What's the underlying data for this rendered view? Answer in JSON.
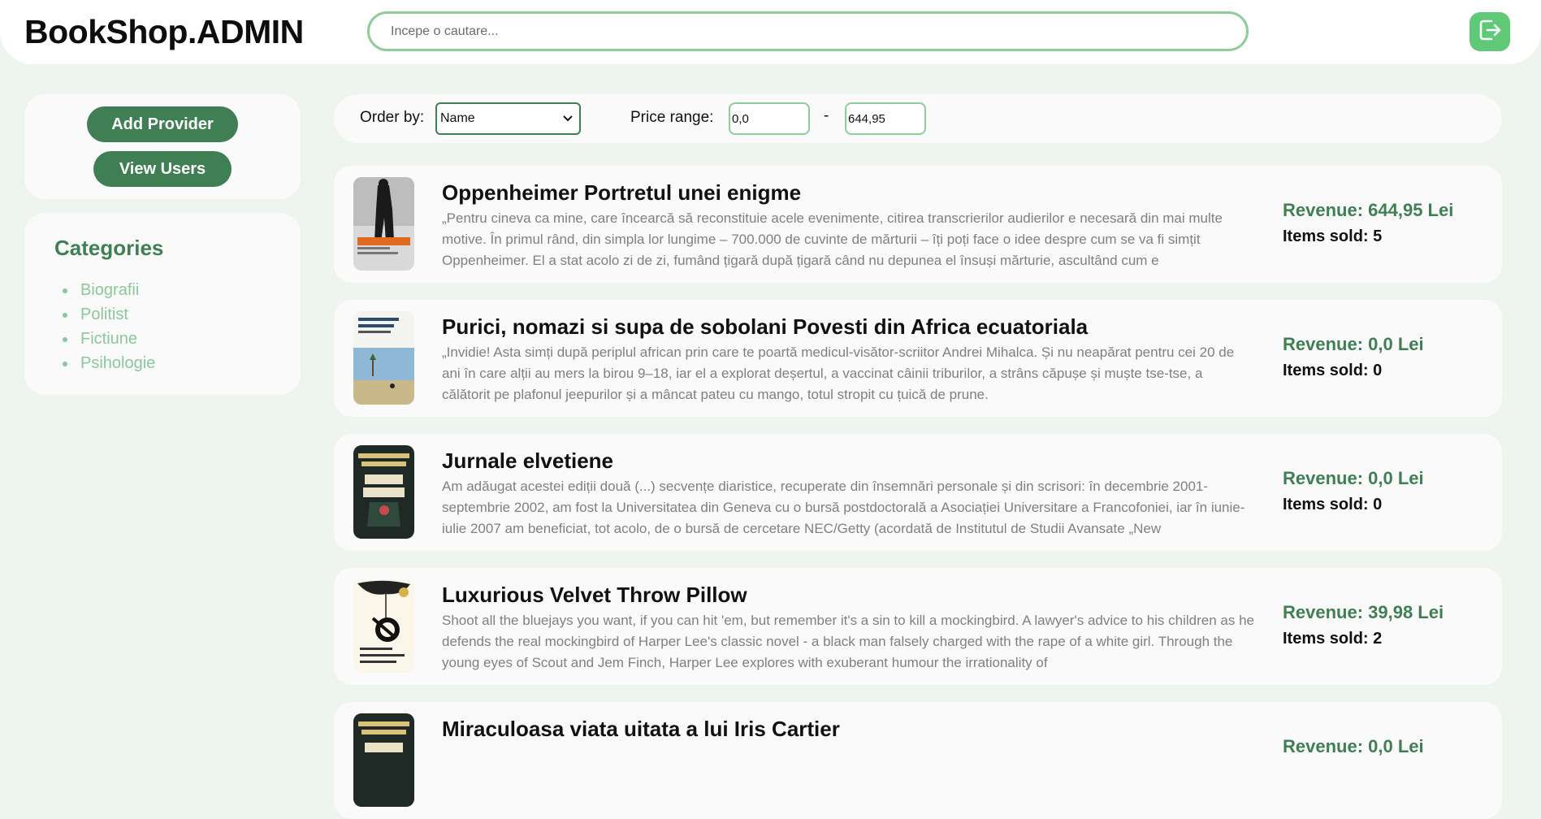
{
  "header": {
    "logo": "BookShop.ADMIN",
    "search_placeholder": "Incepe o cautare...",
    "logout_icon": "logout-icon"
  },
  "sidebar": {
    "add_provider_label": "Add Provider",
    "view_users_label": "View Users",
    "categories_title": "Categories",
    "categories": [
      "Biografii",
      "Politist",
      "Fictiune",
      "Psihologie"
    ]
  },
  "filters": {
    "order_label": "Order by:",
    "order_value": "Name",
    "price_label": "Price range:",
    "price_min": "0,0",
    "price_separator": "-",
    "price_max": "644,95"
  },
  "products": [
    {
      "title": "Oppenheimer Portretul unei enigme",
      "description": "„Pentru cineva ca mine, care încearcă să reconstituie acele evenimente, citirea transcrierilor audierilor e necesară din mai multe motive. În primul rând, din simpla lor lungime – 700.000 de cuvinte de mărturii – îți poți face o idee despre cum se va fi simțit Oppenheimer. El a stat acolo zi de zi, fumând țigară după țigară când nu depunea el însuși mărturie, ascultând cum e",
      "revenue": "Revenue: 644,95 Lei",
      "sold": "Items sold: 5"
    },
    {
      "title": "Purici, nomazi si supa de sobolani Povesti din Africa ecuatoriala",
      "description": "„Invidie! Asta simți după periplul african prin care te poartă medicul-visător-scriitor Andrei Mihalca. Și nu neapărat pentru cei 20 de ani în care alții au mers la birou 9–18, iar el a explorat deșertul, a vaccinat câinii triburilor, a strâns căpușe și muște tse-tse, a călătorit pe plafonul jeepurilor și a mâncat pateu cu mango, totul stropit cu țuică de prune.",
      "revenue": "Revenue: 0,0 Lei",
      "sold": "Items sold: 0"
    },
    {
      "title": "Jurnale elvetiene",
      "description": "Am adăugat acestei ediții două (...) secvențe diaristice, recuperate din însemnări personale și din scrisori: în decembrie 2001-septembrie 2002, am fost la Universitatea din Geneva cu o bursă postdoctorală a Asociației Universitare a Francofoniei, iar în iunie-iulie 2007 am beneficiat, tot acolo, de o bursă de cercetare NEC/Getty (acordată de Institutul de Studii Avansate „New",
      "revenue": "Revenue: 0,0 Lei",
      "sold": "Items sold: 0"
    },
    {
      "title": "Luxurious Velvet Throw Pillow",
      "description": "Shoot all the bluejays you want, if you can hit 'em, but remember it's a sin to kill a mockingbird. A lawyer's advice to his children as he defends the real mockingbird of Harper Lee's classic novel - a black man falsely charged with the rape of a white girl. Through the young eyes of Scout and Jem Finch, Harper Lee explores with exuberant humour the irrationality of",
      "revenue": "Revenue: 39,98 Lei",
      "sold": "Items sold: 2"
    },
    {
      "title": "Miraculoasa viata uitata a lui Iris Cartier",
      "description": "",
      "revenue": "Revenue: 0,0 Lei",
      "sold": ""
    }
  ],
  "colors": {
    "brand_green": "#3f7f53",
    "light_green": "#8cc79a",
    "logout_green": "#5fc978",
    "background": "#eef4ee"
  }
}
